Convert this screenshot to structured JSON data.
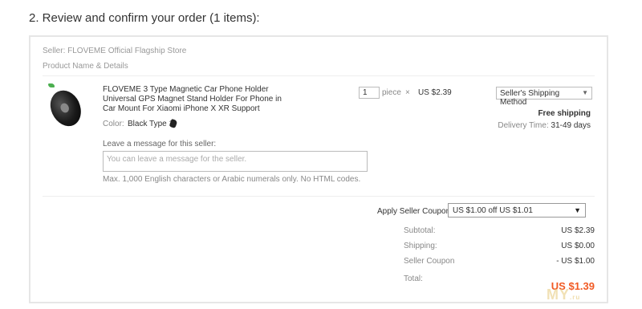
{
  "section": {
    "title": "2. Review and confirm your order (1 items):"
  },
  "seller": {
    "line": "Seller: FLOVEME Official Flagship Store"
  },
  "product_header": "Product Name & Details",
  "product": {
    "title": "FLOVEME 3 Type Magnetic Car Phone Holder Universal GPS Magnet Stand Holder For Phone in Car Mount For Xiaomi iPhone X XR Support",
    "color_label": "Color:",
    "color_value": "Black Type 1",
    "quantity": "1",
    "quantity_unit": "piece",
    "times_sign": "×",
    "unit_price": "US $2.39"
  },
  "shipping": {
    "method": "Seller's Shipping Method",
    "free_shipping": "Free shipping",
    "delivery_label": "Delivery Time:",
    "delivery_days": "31-49 days"
  },
  "message": {
    "label": "Leave a message for this seller:",
    "placeholder": "You can leave a message for the seller.",
    "hint": "Max. 1,000 English characters or Arabic numerals only. No HTML codes."
  },
  "coupon": {
    "label": "Apply Seller Coupon:",
    "selected": "US $1.00 off US $1.01"
  },
  "summary": {
    "subtotal_label": "Subtotal:",
    "subtotal_value": "US $2.39",
    "shipping_label": "Shipping:",
    "shipping_value": "US $0.00",
    "coupon_label": "Seller Coupon",
    "coupon_value": "- US $1.00",
    "total_label": "Total:",
    "total_value": "US $1.39"
  },
  "colors": {
    "total": "#f15a24",
    "border": "#e6e6e6"
  },
  "icons": [
    "product-thumbnail",
    "color-swatch-icon",
    "chevron-down-icon"
  ]
}
